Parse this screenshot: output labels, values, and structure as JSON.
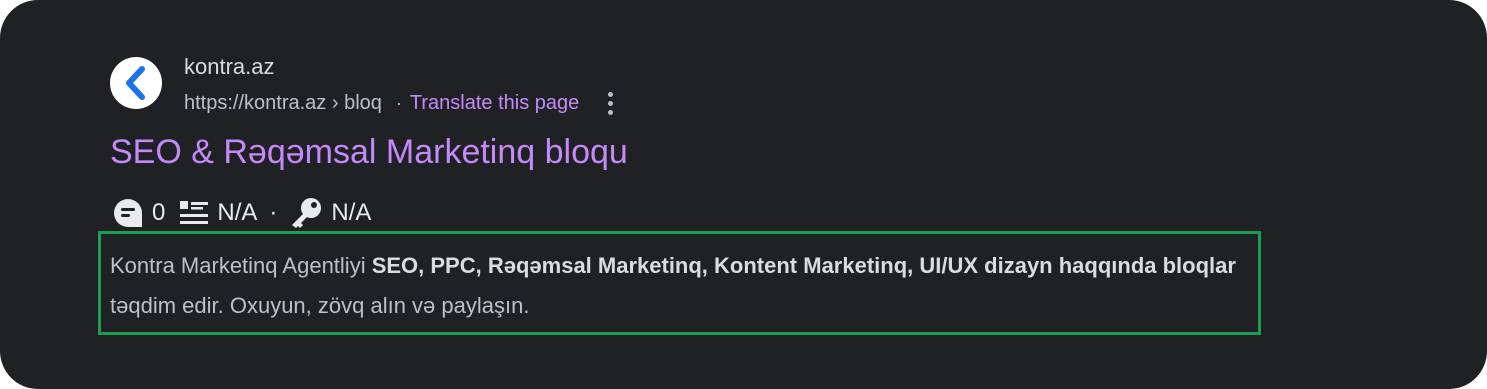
{
  "result": {
    "favicon_icon": "chevron-left-icon",
    "site_name": "kontra.az",
    "url": "https://kontra.az › bloq",
    "separator": "·",
    "translate_label": "Translate this page",
    "menu_icon": "more-vert-icon",
    "title": "SEO & Rəqəmsal Marketinq bloqu",
    "metrics": {
      "comments_icon": "comment-bubble-icon",
      "comments_count": "0",
      "list_icon": "list-icon",
      "list_value": "N/A",
      "separator": "·",
      "key_icon": "key-icon",
      "key_value": "N/A"
    },
    "snippet": {
      "part1": "Kontra Marketinq Agentliyi ",
      "bold1": "SEO, PPC, Rəqəmsal Marketinq, Kontent Marketinq, UI/UX dizayn haqqında bloqlar",
      "part2": " təqdim edir. Oxuyun, zövq alın və paylaşın."
    }
  },
  "colors": {
    "background": "#202124",
    "link_visited": "#c58af9",
    "highlight_border": "#1e9e54",
    "favicon_chevron": "#1a73e8"
  }
}
